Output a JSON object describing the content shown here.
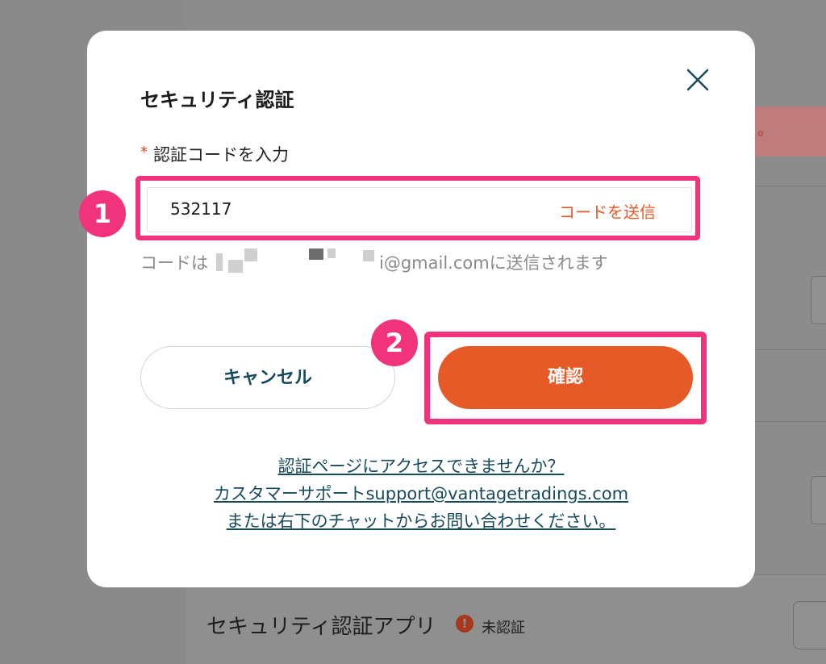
{
  "background": {
    "alert_tail": "。",
    "security_app_title": "セキュリティ認証アプリ",
    "warn_icon": "!",
    "security_app_status": "未認証"
  },
  "modal": {
    "title": "セキュリティ認証",
    "close_icon": "close-icon",
    "required_mark": "*",
    "field_label": "認証コードを入力",
    "code_value": "532117",
    "send_code_label": "コードを送信",
    "hint_prefix": "コードは",
    "hint_suffix": "i@gmail.comに送信されます",
    "cancel_label": "キャンセル",
    "confirm_label": "確認",
    "help_line1": "認証ページにアクセスできませんか？",
    "help_line2": "カスタマーサポートsupport@vantagetradings.com",
    "help_line3": "または右下のチャットからお問い合わせください。"
  },
  "annotations": {
    "badge1": "1",
    "badge2": "2",
    "highlight_color": "#f0337a"
  },
  "colors": {
    "accent": "#e55a26",
    "link": "#174a5c",
    "overlay": "#8a8a8a"
  }
}
